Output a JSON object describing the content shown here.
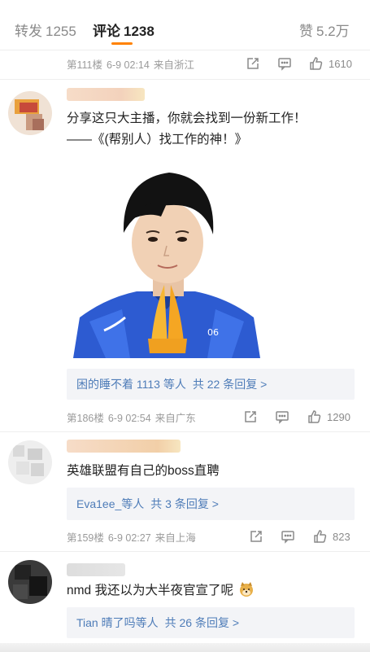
{
  "tabs": {
    "repost_label": "转发",
    "repost_count": "1255",
    "comment_label": "评论",
    "comment_count": "1238",
    "like_label": "赞",
    "like_count": "5.2万"
  },
  "colors": {
    "accent": "#ff8200",
    "link": "#4e7cb8",
    "reply_bg": "#f3f4f7",
    "meta": "#9a9a9a"
  },
  "icons": {
    "share": "share-icon",
    "comment": "comment-icon",
    "like": "thumbs-up-icon",
    "emoji": "doge-emoji"
  },
  "comments": [
    {
      "floor": "第111楼",
      "time": "6-9 02:14",
      "location": "来自浙江",
      "likes": "1610"
    },
    {
      "text_line1": "分享这只大主播，你就会找到一份新工作！",
      "text_line2": "——《(帮别人）找工作的神！》",
      "image_alt": "person-praying-photo",
      "reply_users": "困的睡不着 1113 等人",
      "reply_count": "共 22 条回复 >",
      "floor": "第186楼",
      "time": "6-9 02:54",
      "location": "来自广东",
      "likes": "1290"
    },
    {
      "text": "英雄联盟有自己的boss直聘",
      "reply_users": "Eva1ee_等人",
      "reply_count": "共 3 条回复 >",
      "floor": "第159楼",
      "time": "6-9 02:27",
      "location": "来自上海",
      "likes": "823"
    },
    {
      "text": "nmd 我还以为大半夜官宣了呢",
      "reply_users": "Tian 晴了吗等人",
      "reply_count": "共 26 条回复 >"
    }
  ]
}
